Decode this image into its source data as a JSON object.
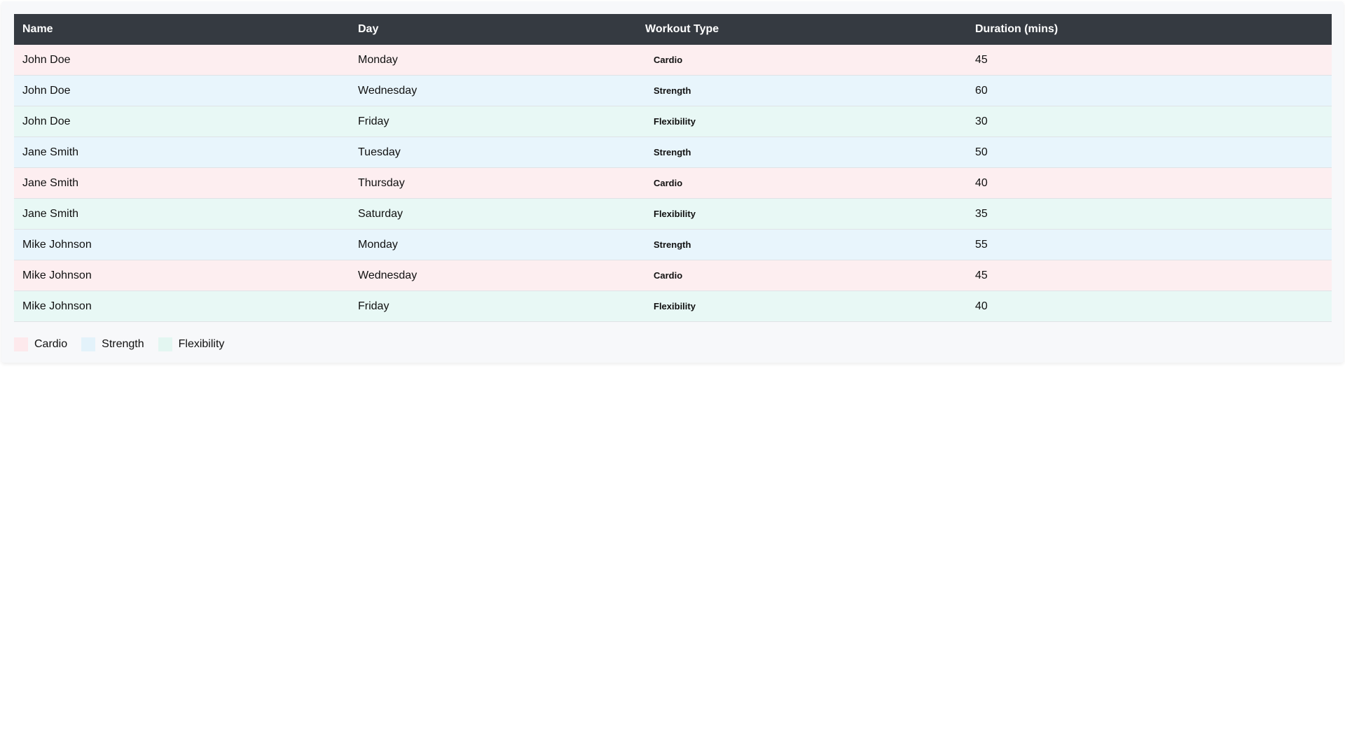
{
  "table": {
    "columns": [
      "Name",
      "Day",
      "Workout Type",
      "Duration (mins)"
    ],
    "rows": [
      {
        "name": "John Doe",
        "day": "Monday",
        "type": "Cardio",
        "duration": "45"
      },
      {
        "name": "John Doe",
        "day": "Wednesday",
        "type": "Strength",
        "duration": "60"
      },
      {
        "name": "John Doe",
        "day": "Friday",
        "type": "Flexibility",
        "duration": "30"
      },
      {
        "name": "Jane Smith",
        "day": "Tuesday",
        "type": "Strength",
        "duration": "50"
      },
      {
        "name": "Jane Smith",
        "day": "Thursday",
        "type": "Cardio",
        "duration": "40"
      },
      {
        "name": "Jane Smith",
        "day": "Saturday",
        "type": "Flexibility",
        "duration": "35"
      },
      {
        "name": "Mike Johnson",
        "day": "Monday",
        "type": "Strength",
        "duration": "55"
      },
      {
        "name": "Mike Johnson",
        "day": "Wednesday",
        "type": "Cardio",
        "duration": "45"
      },
      {
        "name": "Mike Johnson",
        "day": "Friday",
        "type": "Flexibility",
        "duration": "40"
      }
    ]
  },
  "legend": {
    "items": [
      {
        "label": "Cardio",
        "color": "#fde9ec"
      },
      {
        "label": "Strength",
        "color": "#e3f2fa"
      },
      {
        "label": "Flexibility",
        "color": "#e3f6f1"
      }
    ]
  },
  "colors": {
    "header_bg": "#353a41",
    "cardio_row": "#fdeef0",
    "strength_row": "#e8f5fc",
    "flexibility_row": "#e8f8f5"
  }
}
